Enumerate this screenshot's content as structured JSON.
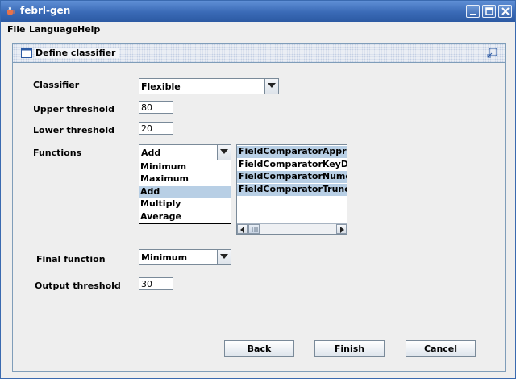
{
  "window": {
    "title": "febrl-gen"
  },
  "menu": {
    "items": [
      "File",
      "Language",
      "Help"
    ]
  },
  "frame": {
    "title": "Define classifier"
  },
  "form": {
    "classifier_label": "Classifier",
    "classifier_value": "Flexible",
    "upper_label": "Upper threshold",
    "upper_value": "80",
    "lower_label": "Lower threshold",
    "lower_value": "20",
    "functions_label": "Functions",
    "functions_value": "Add",
    "functions_options": [
      "Minimum",
      "Maximum",
      "Add",
      "Multiply",
      "Average"
    ],
    "functions_selected": "Add",
    "comparators": [
      "FieldComparatorApproxStrin",
      "FieldComparatorKeyDiff(nam",
      "FieldComparatorNumericPer",
      "FieldComparatorTruncateStr"
    ],
    "final_label": "Final function",
    "final_value": "Minimum",
    "output_label": "Output threshold",
    "output_value": "30"
  },
  "buttons": {
    "back": "Back",
    "finish": "Finish",
    "cancel": "Cancel"
  },
  "icons": {
    "app": "java-cup-icon",
    "frame": "window-icon",
    "maximize": "maximize-icon"
  },
  "colors": {
    "title_bar": "#3a6ab6",
    "selection": "#b8cfe5"
  }
}
